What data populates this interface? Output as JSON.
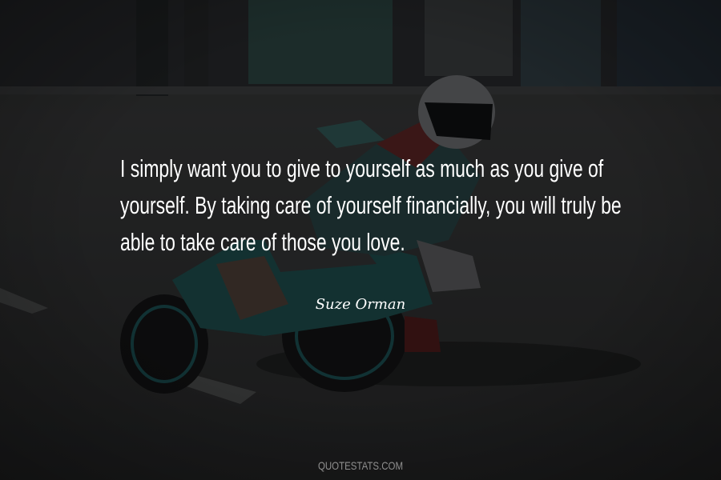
{
  "quote": {
    "lines": [
      "I simply want you to give to yourself as much as you give of",
      "yourself. By taking care of yourself financially, you will truly be",
      "able to take care of those you love."
    ],
    "author": "Suze Orman"
  },
  "footer": {
    "site": "QUOTESTATS.COM"
  },
  "colors": {
    "overlay": "#000000",
    "text": "#ffffff",
    "muted": "#8f8f8f"
  }
}
